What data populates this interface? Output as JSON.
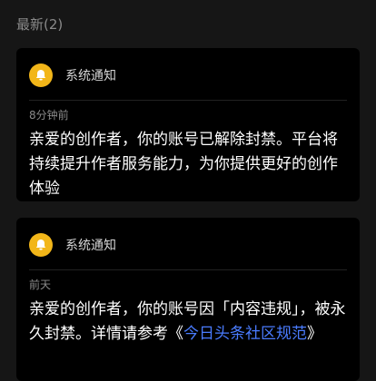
{
  "section": {
    "title": "最新(2)"
  },
  "notifications": [
    {
      "sender": "系统通知",
      "icon": "bell-icon",
      "time": "8分钟前",
      "message": "亲爱的创作者，你的账号已解除封禁。平台将持续提升作者服务能力，为你提供更好的创作体验"
    },
    {
      "sender": "系统通知",
      "icon": "bell-icon",
      "time": "前天",
      "message_prefix": "亲爱的创作者，你的账号因「内容违规」，被永久封禁。详情请参考《",
      "link_text": "今日头条社区规范",
      "message_suffix": "》"
    }
  ],
  "colors": {
    "accent": "#f2b619",
    "link": "#4a7cff",
    "card": "#000000",
    "background": "#161616"
  }
}
